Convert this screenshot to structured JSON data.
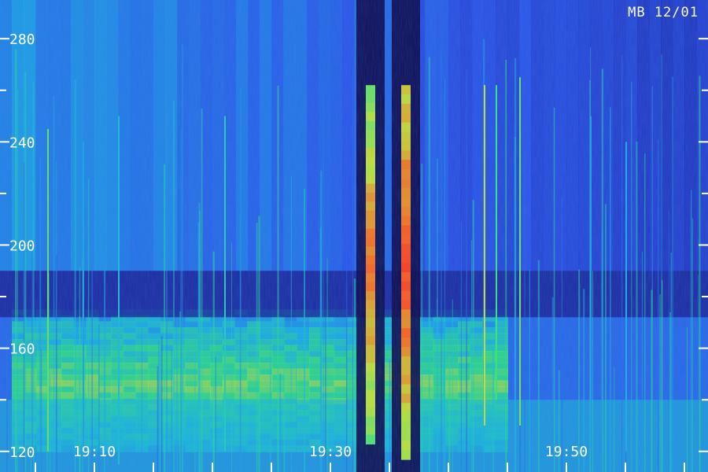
{
  "header": {
    "station_label": "MB 12/01"
  },
  "chart_data": {
    "type": "heatmap",
    "title": "",
    "xlabel": "",
    "ylabel": "",
    "x_axis": {
      "type": "time",
      "range": [
        "19:02",
        "20:02"
      ],
      "tick_labels": [
        "19:10",
        "19:30",
        "19:50"
      ],
      "major_tick_times": [
        "19:10",
        "19:30",
        "19:50"
      ],
      "minor_tick_step_minutes": 5
    },
    "y_axis": {
      "range": [
        112,
        295
      ],
      "tick_values": [
        120,
        160,
        200,
        240,
        280
      ],
      "tick_labels": [
        "120",
        "160",
        "200",
        "240",
        "280"
      ],
      "minor_tick_step": 20
    },
    "colormap": [
      "#050018",
      "#1a1a9a",
      "#2b52e6",
      "#19b7e0",
      "#2ee87a",
      "#c4e632",
      "#ff6a1a",
      "#ff2a1a"
    ],
    "background_level": 0.32,
    "broadband_band": {
      "time_range": [
        "19:03",
        "19:45"
      ],
      "freq_range": [
        120,
        175
      ],
      "intensity": 0.62
    },
    "lower_band": {
      "time_range": [
        "19:02",
        "20:02"
      ],
      "freq_range": [
        112,
        140
      ],
      "intensity": 0.45
    },
    "dark_gap": {
      "time_range": [
        "19:02",
        "20:02"
      ],
      "freq_range": [
        172,
        190
      ],
      "intensity": 0.12
    },
    "strong_traces": [
      {
        "time": "19:33",
        "freq_range": [
          123,
          262
        ],
        "intensity": 0.85,
        "peak_freq": 195
      },
      {
        "time": "19:36",
        "freq_range": [
          117,
          262
        ],
        "intensity": 0.92,
        "peak_freq": 195
      }
    ],
    "thin_lines": [
      {
        "time": "19:06",
        "freq_range": [
          120,
          245
        ],
        "intensity": 0.62
      },
      {
        "time": "19:09",
        "freq_range": [
          118,
          240
        ],
        "intensity": 0.4
      },
      {
        "time": "19:12",
        "freq_range": [
          115,
          250
        ],
        "intensity": 0.45
      },
      {
        "time": "19:21",
        "freq_range": [
          120,
          250
        ],
        "intensity": 0.5
      },
      {
        "time": "19:43",
        "freq_range": [
          130,
          262
        ],
        "intensity": 0.72
      },
      {
        "time": "19:44",
        "freq_range": [
          140,
          262
        ],
        "intensity": 0.58
      },
      {
        "time": "19:46",
        "freq_range": [
          130,
          265
        ],
        "intensity": 0.64
      },
      {
        "time": "19:52",
        "freq_range": [
          120,
          250
        ],
        "intensity": 0.4
      },
      {
        "time": "19:55",
        "freq_range": [
          120,
          240
        ],
        "intensity": 0.42
      }
    ]
  }
}
